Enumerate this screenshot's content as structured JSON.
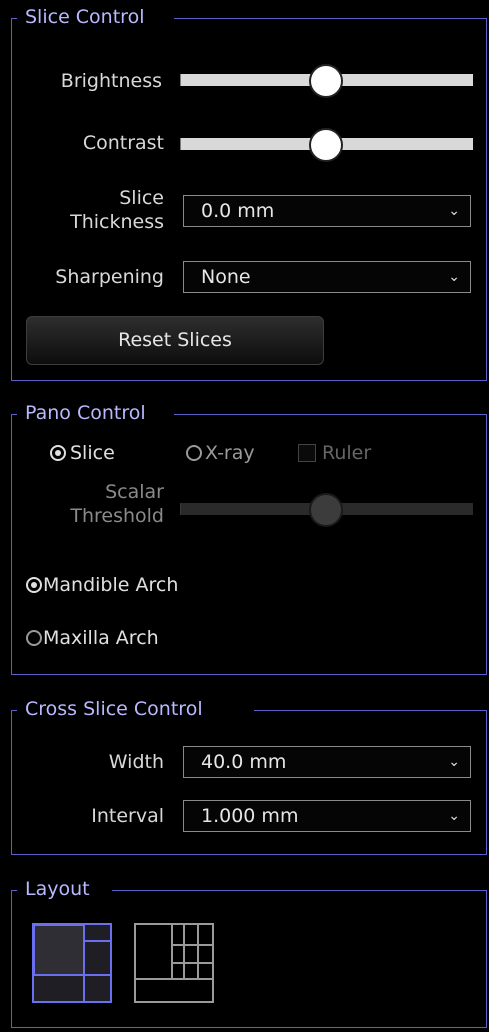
{
  "slice_control": {
    "title": "Slice Control",
    "brightness_label": "Brightness",
    "brightness_value": 0.5,
    "contrast_label": "Contrast",
    "contrast_value": 0.5,
    "slice_thickness_label_line1": "Slice",
    "slice_thickness_label_line2": "Thickness",
    "slice_thickness_value": "0.0 mm",
    "sharpening_label": "Sharpening",
    "sharpening_value": "None",
    "reset_button": "Reset Slices"
  },
  "pano_control": {
    "title": "Pano Control",
    "mode_slice": "Slice",
    "mode_xray": "X-ray",
    "ruler_label": "Ruler",
    "scalar_threshold_line1": "Scalar",
    "scalar_threshold_line2": "Threshold",
    "scalar_threshold_value": 0.5,
    "mandible_arch": "Mandible Arch",
    "maxilla_arch": "Maxilla Arch"
  },
  "cross_slice_control": {
    "title": "Cross Slice Control",
    "width_label": "Width",
    "width_value": "40.0 mm",
    "interval_label": "Interval",
    "interval_value": "1.000 mm"
  },
  "layout": {
    "title": "Layout",
    "options": [
      "layout-large-left-icon",
      "layout-grid-top-icon"
    ],
    "selected": "layout-large-left-icon",
    "colors": {
      "accent": "#6a6ff0",
      "panel_border": "#5b5fc7"
    }
  }
}
